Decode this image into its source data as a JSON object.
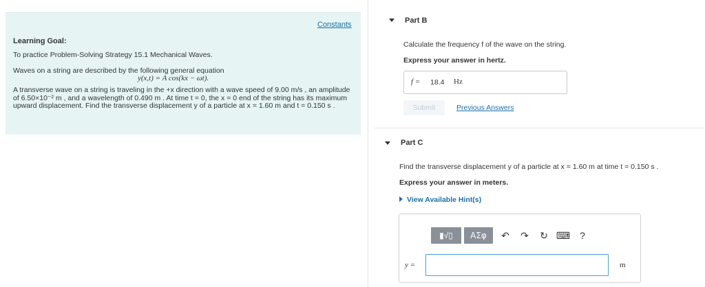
{
  "left_panel": {
    "constants_link": "Constants",
    "goal_title": "Learning Goal:",
    "goal_text": "To practice Problem-Solving Strategy 15.1 Mechanical Waves.",
    "eq_intro": "Waves on a string are described by the following general equation",
    "equation": "y(x,t) = A cos(kx − ωt).",
    "problem_text": "A transverse wave on a string is traveling in the +x direction with a wave speed of 9.00 m/s , an amplitude of 6.50×10⁻² m , and a wavelength of 0.490 m . At time t = 0, the x = 0 end of the string has its maximum upward displacement. Find the transverse displacement y of a particle at x = 1.60 m and t = 0.150 s ."
  },
  "part_b": {
    "title": "Part B",
    "question": "Calculate the frequency f of the wave on the string.",
    "instruction": "Express your answer in hertz.",
    "answer_label": "f =",
    "answer_value": "18.4",
    "answer_unit": "Hz",
    "submit_label": "Submit",
    "previous_answers_label": "Previous Answers"
  },
  "part_c": {
    "title": "Part C",
    "question": "Find the transverse displacement y of a particle at x = 1.60 m at time t = 0.150 s .",
    "instruction": "Express your answer in meters.",
    "hint_label": "View Available Hint(s)",
    "input_label": "y =",
    "input_value": "",
    "input_unit": "m",
    "toolbar": {
      "template_btn": "▮√▯",
      "greek_btn": "ΑΣφ",
      "undo_icon": "↶",
      "redo_icon": "↷",
      "reset_icon": "↻",
      "keyboard_icon": "⌨",
      "help_icon": "?"
    }
  },
  "colors": {
    "accent": "#1a6fa8",
    "panel_bg": "#e6f4f4",
    "toolbar_btn": "#8a8f98"
  }
}
